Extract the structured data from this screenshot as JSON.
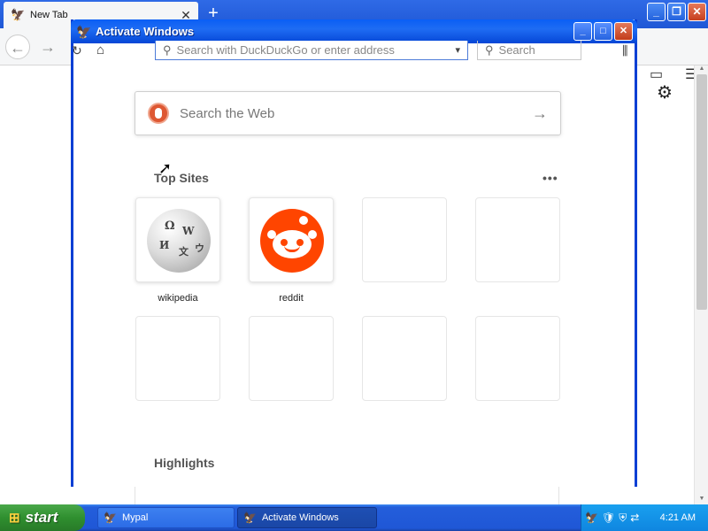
{
  "browser": {
    "tab_title": "New Tab",
    "tab_close": "✕",
    "new_tab": "+",
    "url_placeholder": "Search with DuckDuckGo or enter address",
    "search_placeholder": "Search",
    "window_buttons": {
      "minimize": "_",
      "restore": "❐",
      "close": "✕"
    }
  },
  "dialog": {
    "title": "Activate Windows",
    "buttons": {
      "minimize": "_",
      "maximize": "□",
      "close": "✕"
    }
  },
  "newtab": {
    "search_placeholder": "Search the Web",
    "top_sites_title": "Top Sites",
    "more_label": "•••",
    "highlights_title": "Highlights",
    "sites": [
      {
        "label": "wikipedia"
      },
      {
        "label": "reddit"
      },
      {
        "label": ""
      },
      {
        "label": ""
      },
      {
        "label": ""
      },
      {
        "label": ""
      },
      {
        "label": ""
      },
      {
        "label": ""
      }
    ]
  },
  "taskbar": {
    "start_label": "start",
    "items": [
      {
        "label": "Mypal",
        "active": false
      },
      {
        "label": "Activate Windows",
        "active": true
      }
    ],
    "clock": "4:21 AM"
  },
  "colors": {
    "xp_blue": "#1f57d6",
    "start_green": "#2f8f2f",
    "reddit_orange": "#ff4500",
    "ddg_orange": "#de5833"
  }
}
